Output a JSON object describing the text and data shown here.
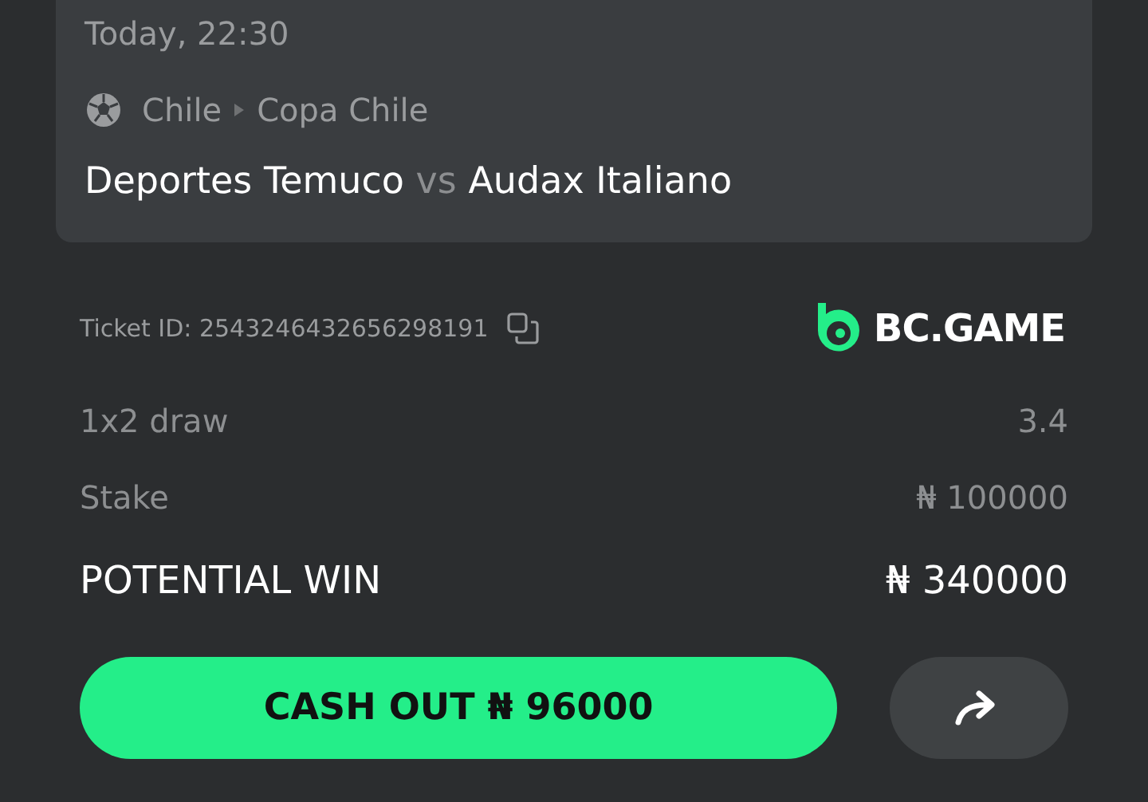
{
  "event": {
    "time": "Today, 22:30",
    "country": "Chile",
    "league": "Copa Chile",
    "home": "Deportes Temuco",
    "vs": "vs",
    "away": "Audax Italiano"
  },
  "ticket": {
    "label": "Ticket ID: 2543246432656298191",
    "brand": "BC.GAME"
  },
  "rows": [
    {
      "kind": "normal",
      "label": "1x2 draw",
      "value": "3.4"
    },
    {
      "kind": "normal",
      "label": "Stake",
      "value": "₦ 100000"
    },
    {
      "kind": "total",
      "label": "POTENTIAL WIN",
      "value": "₦ 340000"
    }
  ],
  "cashout_button": "CASH OUT ₦ 96000"
}
